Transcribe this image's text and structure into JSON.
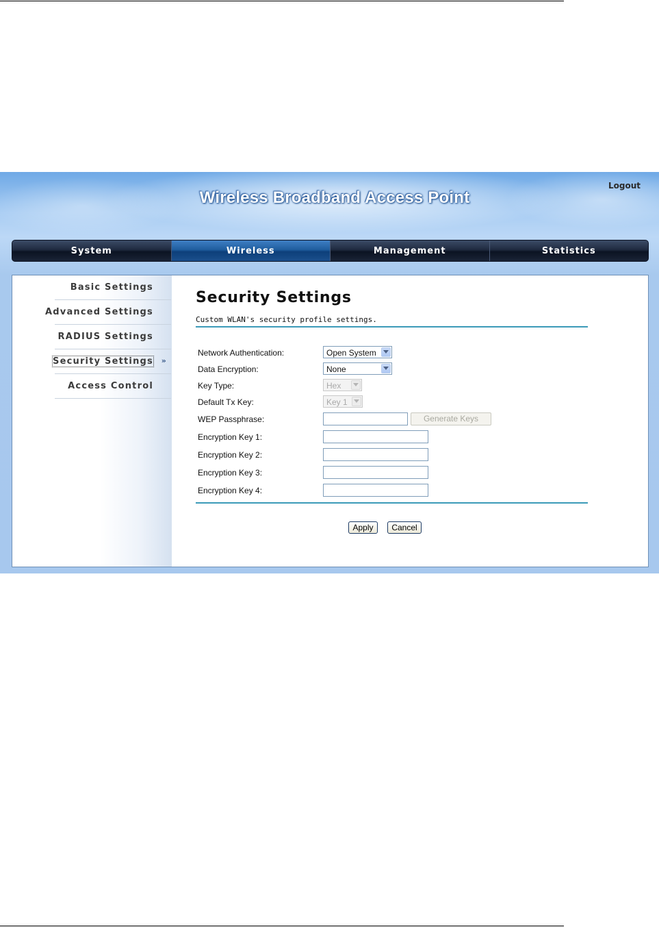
{
  "app": {
    "title": "Wireless Broadband Access Point",
    "logout_label": "Logout"
  },
  "nav": {
    "tabs": [
      {
        "label": "System"
      },
      {
        "label": "Wireless"
      },
      {
        "label": "Management"
      },
      {
        "label": "Statistics"
      }
    ],
    "active": "Wireless"
  },
  "sidebar": {
    "items": [
      {
        "label": "Basic Settings"
      },
      {
        "label": "Advanced Settings"
      },
      {
        "label": "RADIUS Settings"
      },
      {
        "label": "Security Settings"
      },
      {
        "label": "Access Control"
      }
    ],
    "active": "Security Settings",
    "active_marker": "»"
  },
  "main": {
    "title": "Security Settings",
    "description": "Custom WLAN's security profile settings.",
    "form": {
      "network_authentication": {
        "label": "Network Authentication:",
        "value": "Open System"
      },
      "data_encryption": {
        "label": "Data Encryption:",
        "value": "None"
      },
      "key_type": {
        "label": "Key Type:",
        "value": "Hex"
      },
      "default_tx_key": {
        "label": "Default Tx Key:",
        "value": "Key 1"
      },
      "wep_passphrase": {
        "label": "WEP Passphrase:",
        "value": ""
      },
      "generate_keys_label": "Generate Keys",
      "encryption_keys": [
        {
          "label": "Encryption Key 1:",
          "value": ""
        },
        {
          "label": "Encryption Key 2:",
          "value": ""
        },
        {
          "label": "Encryption Key 3:",
          "value": ""
        },
        {
          "label": "Encryption Key 4:",
          "value": ""
        }
      ]
    },
    "apply_label": "Apply",
    "cancel_label": "Cancel"
  },
  "colors": {
    "accent_rule": "#3b9ab8",
    "nav_active": "#1f5d9e",
    "nav_bar": "#0b1322"
  }
}
